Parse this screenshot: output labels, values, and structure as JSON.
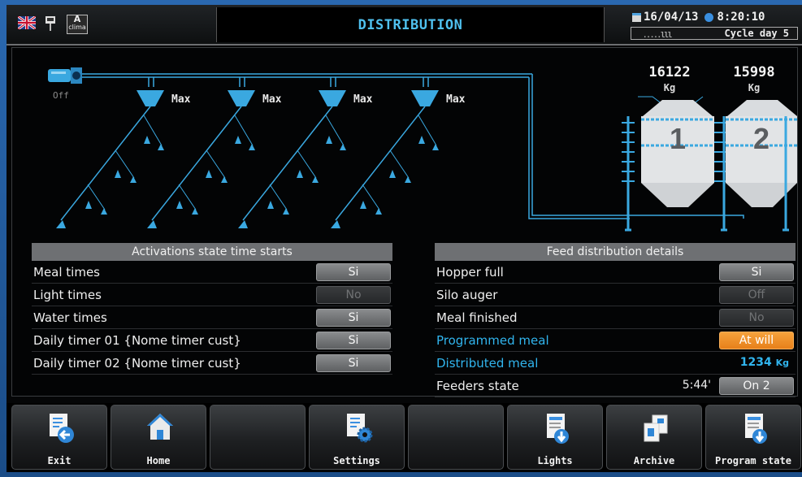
{
  "header": {
    "title": "DISTRIBUTION",
    "language_flag": "uk-flag-icon",
    "clima_badge": {
      "top": "A",
      "bottom": "clima"
    },
    "date": "16/04/13",
    "time": "8:20:10",
    "signal": ".....lll",
    "cycle_day": "Cycle day 5"
  },
  "plant": {
    "motor_state": "Off",
    "hopper_labels": [
      "Max",
      "Max",
      "Max",
      "Max"
    ],
    "silos": [
      {
        "weight": "16122",
        "unit": "Kg",
        "number": "1"
      },
      {
        "weight": "15998",
        "unit": "Kg",
        "number": "2"
      }
    ]
  },
  "activations": {
    "title": "Activations state time starts",
    "rows": [
      {
        "label": "Meal times",
        "value": "Si",
        "state": "on"
      },
      {
        "label": "Light times",
        "value": "No",
        "state": "dim"
      },
      {
        "label": "Water times",
        "value": "Si",
        "state": "on"
      },
      {
        "label": "Daily timer 01 {Nome timer cust}",
        "value": "Si",
        "state": "on"
      },
      {
        "label": "Daily timer 02 {Nome timer cust}",
        "value": "Si",
        "state": "on"
      }
    ]
  },
  "feed": {
    "title": "Feed distribution details",
    "rows": [
      {
        "label": "Hopper full",
        "value": "Si",
        "state": "on"
      },
      {
        "label": "Silo auger",
        "value": "Off",
        "state": "dim"
      },
      {
        "label": "Meal finished",
        "value": "No",
        "state": "dim"
      },
      {
        "label": "Programmed meal",
        "value": "At will",
        "state": "orange"
      },
      {
        "label": "Distributed meal",
        "value": "1234",
        "unit": "Kg",
        "state": "plain"
      },
      {
        "label": "Feeders state",
        "time": "5:44'",
        "value": "On 2",
        "state": "on"
      }
    ]
  },
  "toolbar": {
    "buttons": [
      {
        "label": "Exit",
        "icon": "exit-icon"
      },
      {
        "label": "Home",
        "icon": "home-icon"
      },
      {
        "label": "",
        "icon": ""
      },
      {
        "label": "Settings",
        "icon": "settings-icon"
      },
      {
        "label": "",
        "icon": ""
      },
      {
        "label": "Lights",
        "icon": "lights-icon"
      },
      {
        "label": "Archive",
        "icon": "archive-icon"
      },
      {
        "label": "Program state",
        "icon": "program-state-icon"
      }
    ]
  },
  "colors": {
    "accent_blue": "#31b5ee",
    "orange": "#f08c28",
    "pill_gray": "#7a7c7e"
  }
}
